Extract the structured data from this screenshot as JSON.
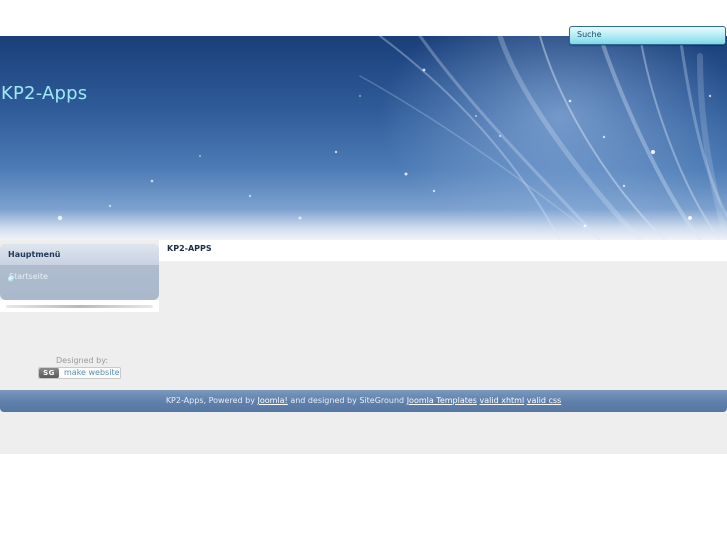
{
  "search": {
    "label": "Suche"
  },
  "header": {
    "site_title": "KP2-Apps"
  },
  "sidebar": {
    "module_title": "Hauptmenü",
    "items": [
      {
        "label": "Startseite"
      }
    ]
  },
  "content": {
    "title": "KP2-APPS"
  },
  "designer": {
    "label": "Designed by:",
    "logo_text": "SG",
    "link_text": "make website"
  },
  "footer": {
    "prefix": "KP2-Apps, Powered by",
    "joomla_link": "Joomla!",
    "middle": "and designed by SiteGround",
    "templates_link": "Joomla Templates",
    "xhtml_link": "valid xhtml",
    "css_link": "valid css"
  },
  "colors": {
    "header_dark": "#1a3f79",
    "header_light": "#7da2cf",
    "title_accent": "#9fe8f7",
    "footer_bar": "#5f80aa",
    "search_fill": "#b9eef6"
  }
}
